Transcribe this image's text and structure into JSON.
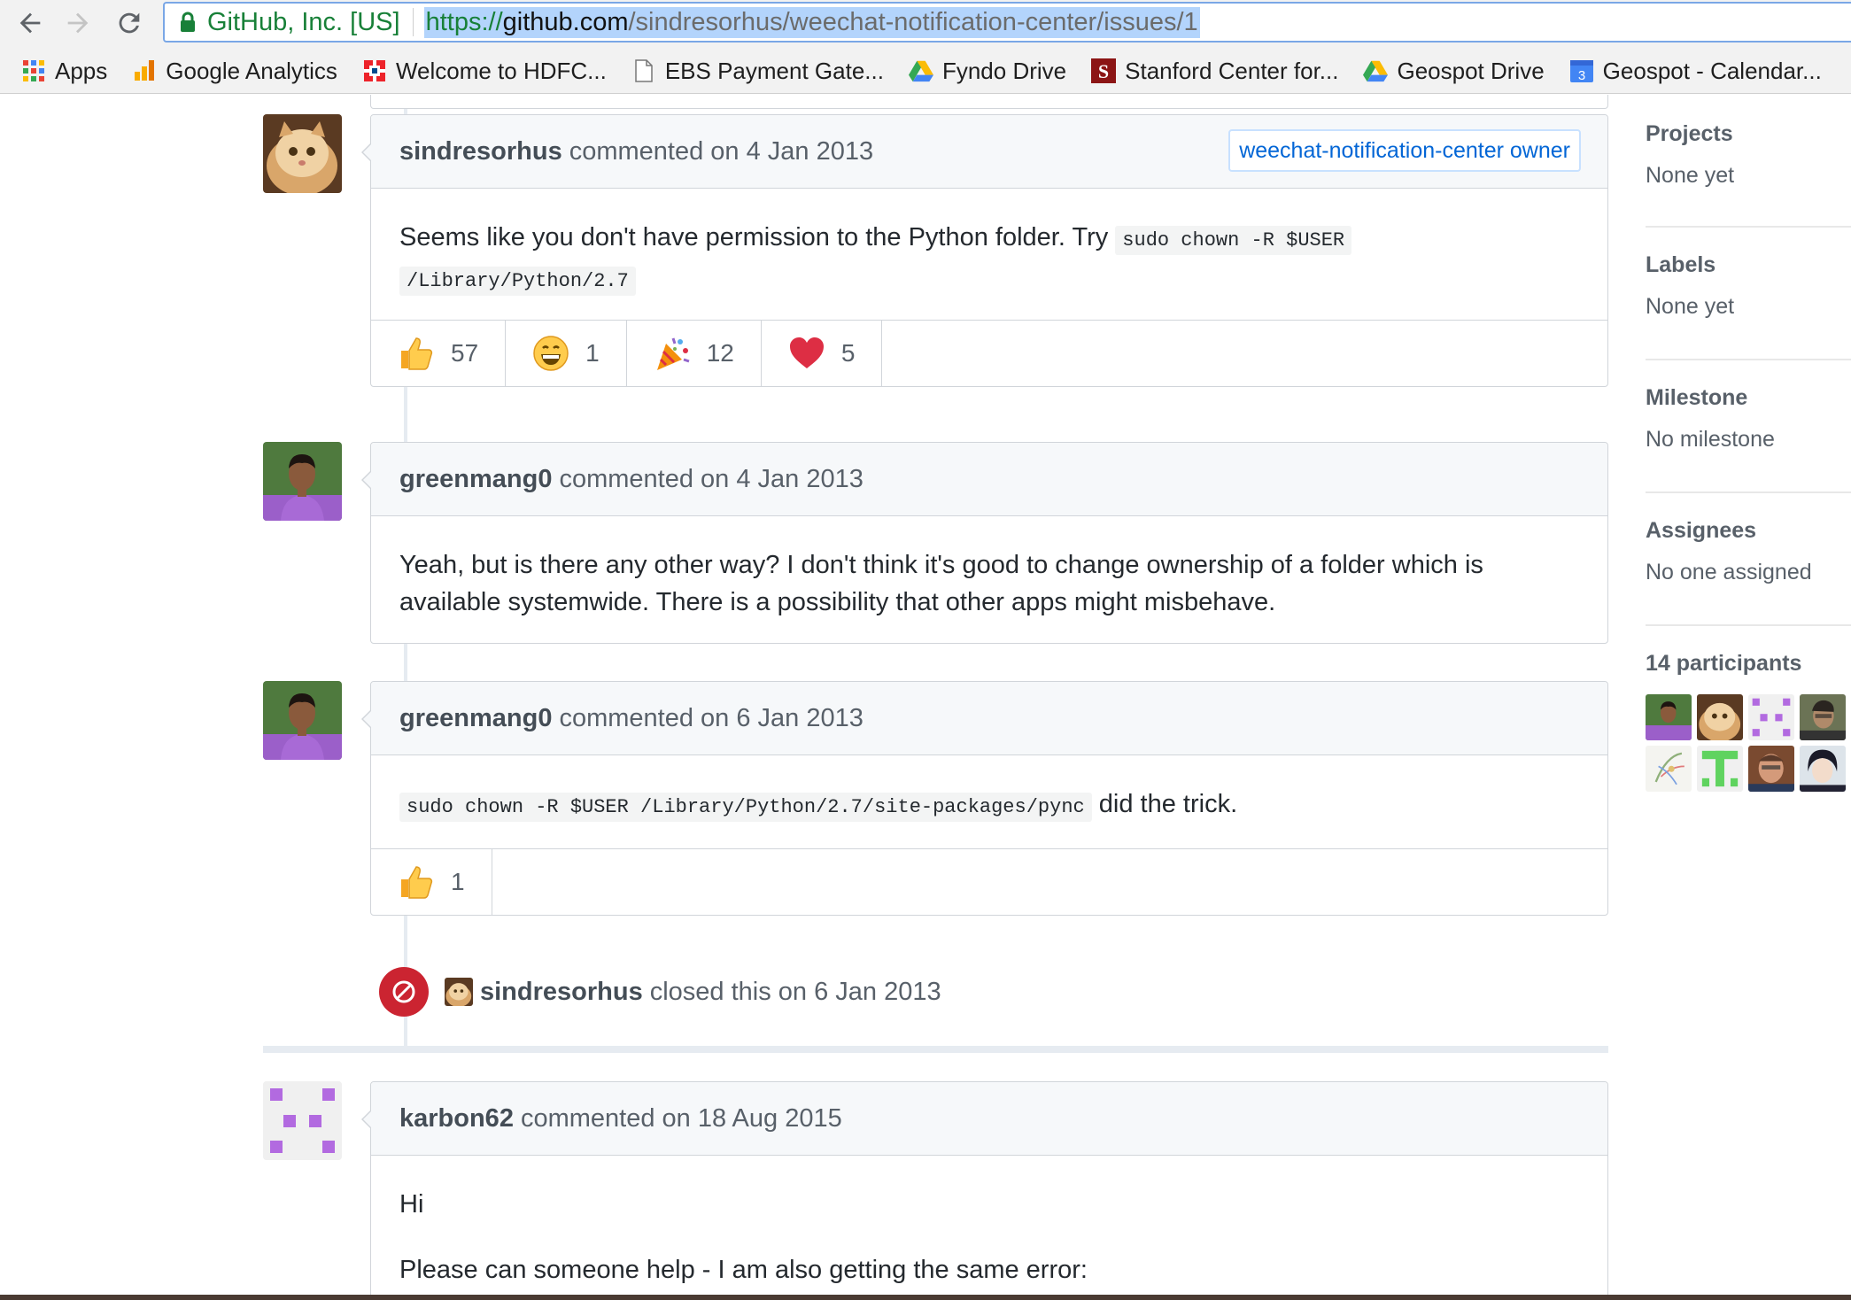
{
  "browser": {
    "site_identity": "GitHub, Inc. [US]",
    "url_scheme": "https://",
    "url_host": "github.com",
    "url_path": "/sindresorhus/weechat-notification-center/issues/1",
    "bookmarks": [
      {
        "label": "Apps",
        "icon": "apps-grid-icon"
      },
      {
        "label": "Google Analytics",
        "icon": "analytics-icon"
      },
      {
        "label": "Welcome to HDFC...",
        "icon": "hdfc-icon"
      },
      {
        "label": "EBS Payment Gate...",
        "icon": "document-icon"
      },
      {
        "label": "Fyndo Drive",
        "icon": "google-drive-icon"
      },
      {
        "label": "Stanford Center for...",
        "icon": "stanford-icon"
      },
      {
        "label": "Geospot Drive",
        "icon": "google-drive-icon"
      },
      {
        "label": "Geospot - Calendar...",
        "icon": "calendar-icon"
      }
    ],
    "calendar_icon_number": "3"
  },
  "comments": [
    {
      "author": "sindresorhus",
      "action": "commented on 4 Jan 2013",
      "badge": "weechat-notification-center owner",
      "text_before_code": "Seems like you don't have permission to the Python folder. Try ",
      "code_line1": "sudo chown -R $USER",
      "code_line2": "/Library/Python/2.7",
      "reactions": [
        {
          "emoji": "thumbs-up",
          "count": "57"
        },
        {
          "emoji": "smile",
          "count": "1"
        },
        {
          "emoji": "tada",
          "count": "12"
        },
        {
          "emoji": "heart",
          "count": "5"
        }
      ]
    },
    {
      "author": "greenmang0",
      "action": "commented on 4 Jan 2013",
      "text": "Yeah, but is there any other way? I don't think it's good to change ownership of a folder which is available systemwide. There is a possibility that other apps might misbehave."
    },
    {
      "author": "greenmang0",
      "action": "commented on 6 Jan 2013",
      "code": "sudo chown -R $USER /Library/Python/2.7/site-packages/pync",
      "text_after_code": " did the trick.",
      "reactions": [
        {
          "emoji": "thumbs-up",
          "count": "1"
        }
      ]
    },
    {
      "author": "karbon62",
      "action": "commented on 18 Aug 2015",
      "para1": "Hi",
      "para2": "Please can someone help - I am also getting the same error:"
    }
  ],
  "closed_event": {
    "author": "sindresorhus",
    "action": "closed this on 6 Jan 2013"
  },
  "sidebar": {
    "projects_title": "Projects",
    "projects_value": "None yet",
    "labels_title": "Labels",
    "labels_value": "None yet",
    "milestone_title": "Milestone",
    "milestone_value": "No milestone",
    "assignees_title": "Assignees",
    "assignees_value": "No one assigned",
    "participants_title": "14 participants",
    "participant_count_shown": 8
  },
  "colors": {
    "link_blue": "#0366d6",
    "closed_red": "#cb2431",
    "secure_green": "#188038",
    "url_highlight": "#b3d4fc"
  }
}
